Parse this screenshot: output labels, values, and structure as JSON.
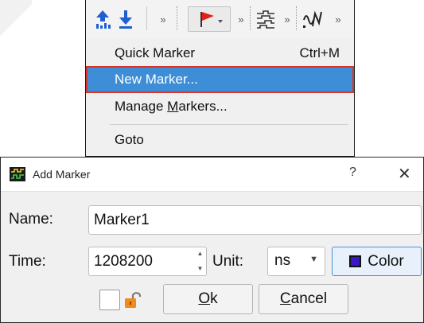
{
  "menu": {
    "items": [
      {
        "label": "Quick Marker",
        "shortcut": "Ctrl+M"
      },
      {
        "label": "New Marker...",
        "shortcut": ""
      },
      {
        "label": "Manage Markers...",
        "shortcut": ""
      },
      {
        "label": "Goto",
        "shortcut": ""
      }
    ],
    "toolbar": {
      "icons": [
        "move-up-icon",
        "move-down-icon",
        "flag-marker-icon",
        "signal-icon",
        "wave-icon"
      ],
      "overflow_glyph": "»"
    }
  },
  "dialog": {
    "title": "Add Marker",
    "help_glyph": "?",
    "close_glyph": "✕",
    "name_label": "Name:",
    "name_value": "Marker1",
    "time_label": "Time:",
    "time_value": "1208200",
    "unit_label": "Unit:",
    "unit_value": "ns",
    "color_button": "Color",
    "ok_button_prefix": "",
    "ok_button_ul": "O",
    "ok_button_rest": "k",
    "cancel_button_ul": "C",
    "cancel_button_rest": "ancel",
    "selected_color": "#3a16c9"
  },
  "colors": {
    "highlight": "#3d8ed6",
    "highlight_border": "#d6362c",
    "flag": "#e0201a"
  }
}
